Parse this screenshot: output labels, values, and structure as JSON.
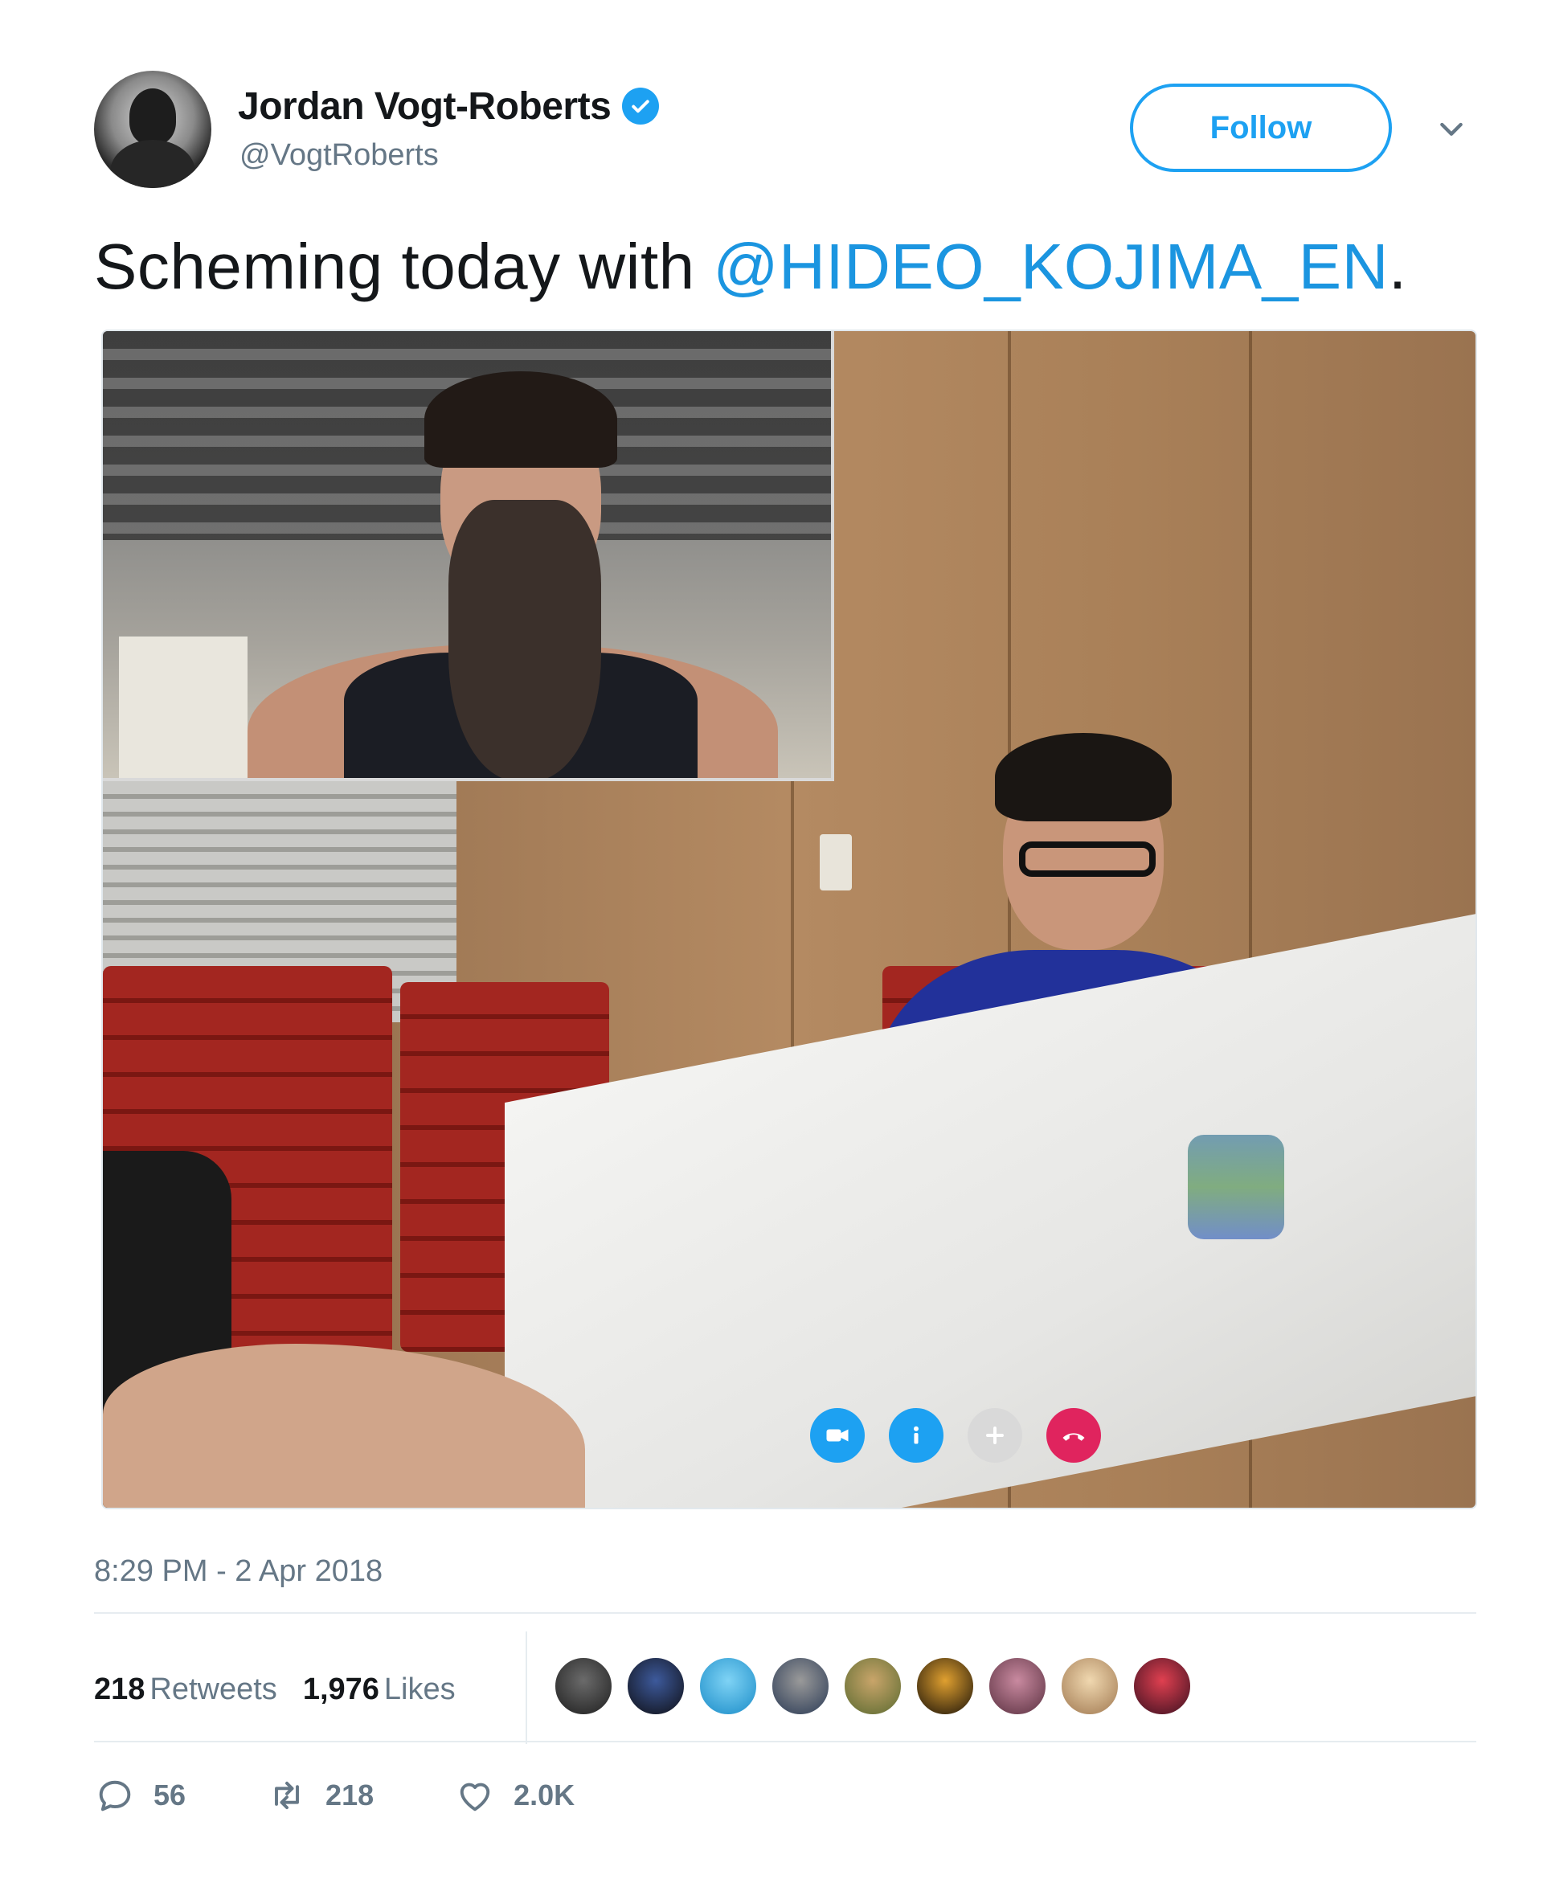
{
  "author": {
    "display_name": "Jordan Vogt-Roberts",
    "handle": "@VogtRoberts",
    "verified": true,
    "avatar_icon": "profile-photo"
  },
  "header": {
    "follow_label": "Follow",
    "menu_icon": "chevron-down-icon"
  },
  "tweet": {
    "text_prefix": "Scheming today with ",
    "mention": "@HIDEO_KOJIMA_EN",
    "text_suffix": "."
  },
  "media": {
    "call_controls": [
      {
        "icon": "video-camera-icon",
        "color": "#1da1f2"
      },
      {
        "icon": "info-icon",
        "color": "#1da1f2"
      },
      {
        "icon": "add-icon",
        "color": "#d9d9d9"
      },
      {
        "icon": "hang-up-icon",
        "color": "#e0245e"
      }
    ]
  },
  "meta": {
    "timestamp": "8:29 PM - 2 Apr 2018"
  },
  "stats": {
    "retweets_count": "218",
    "retweets_label": "Retweets",
    "likes_count": "1,976",
    "likes_label": "Likes",
    "liker_avatars": 9
  },
  "actions": {
    "replies": "56",
    "retweets": "218",
    "likes": "2.0K"
  },
  "colors": {
    "accent": "#1da1f2",
    "mention": "#1b95e0",
    "muted": "#657786",
    "text": "#14171a"
  }
}
